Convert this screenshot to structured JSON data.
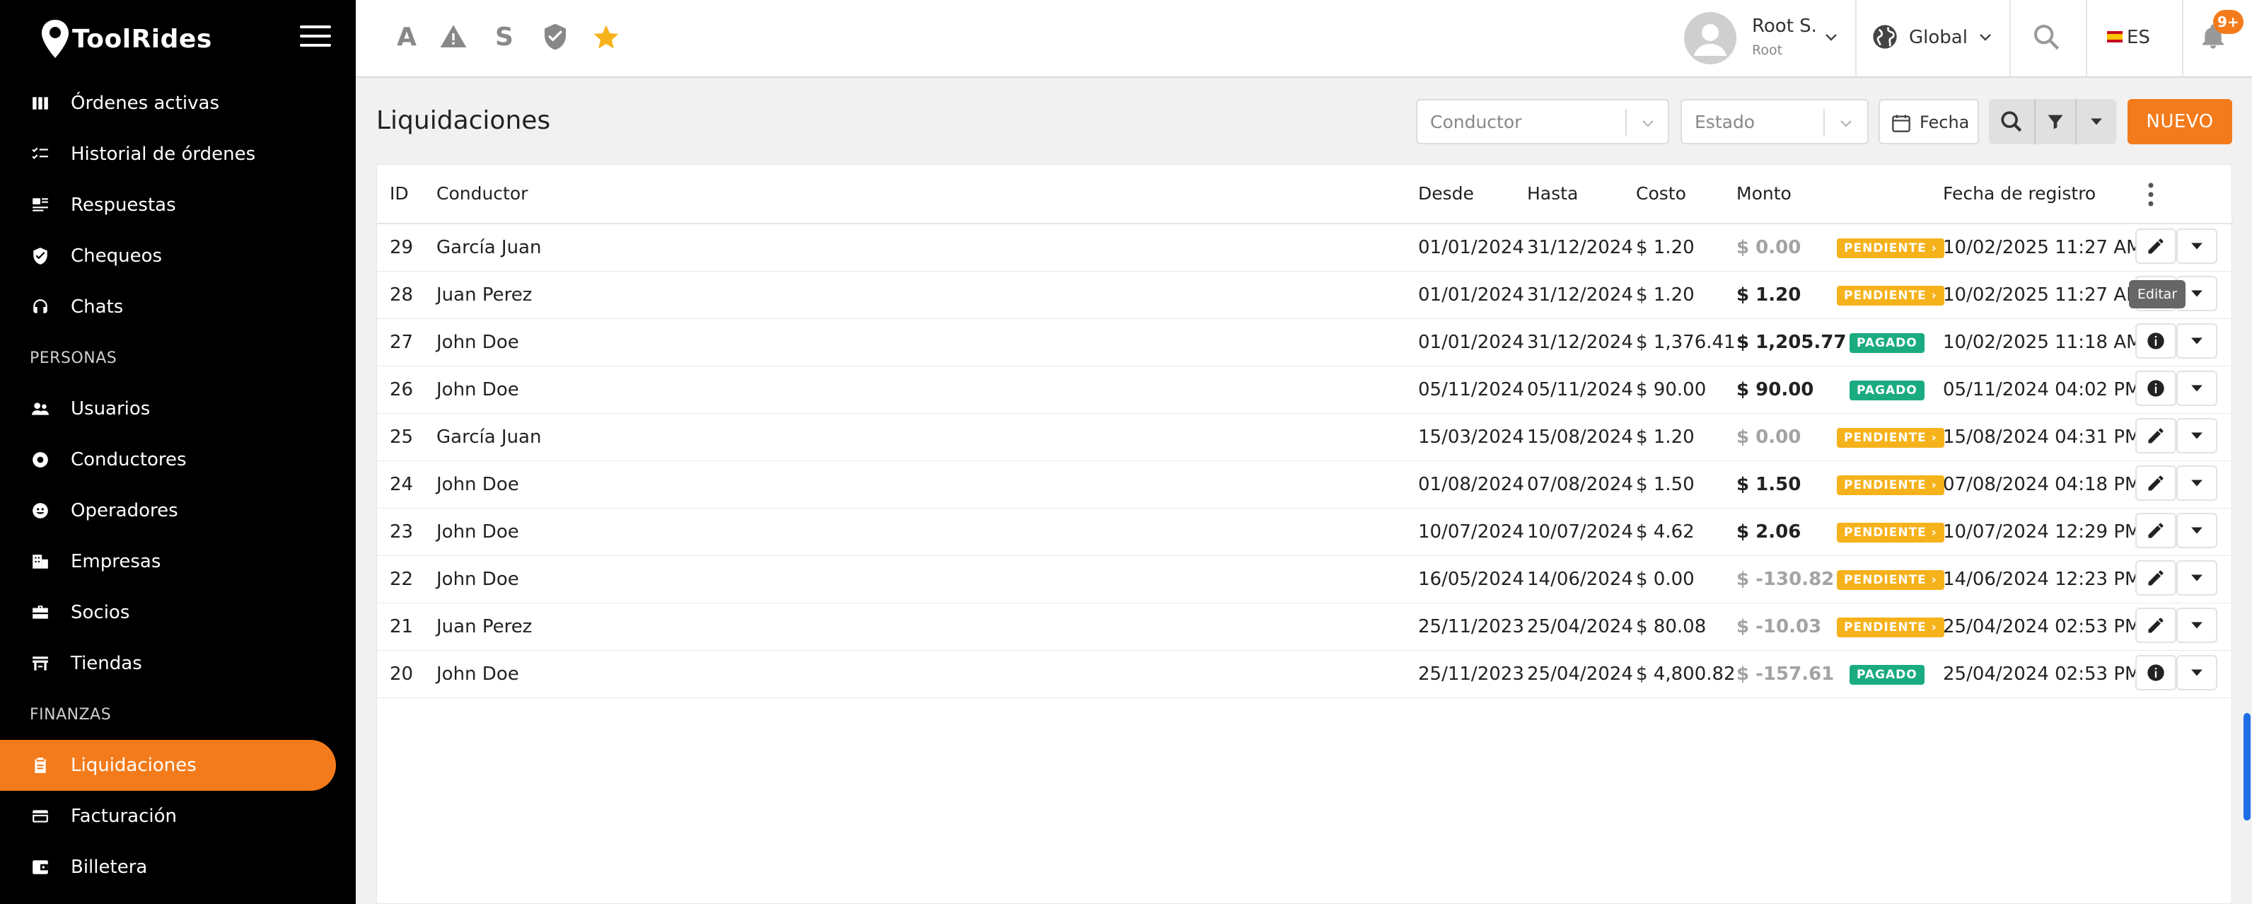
{
  "brand": {
    "name": "ToolRides"
  },
  "sidebar": {
    "items": [
      {
        "label": "Órdenes activas",
        "icon": "columns-icon"
      },
      {
        "label": "Historial de órdenes",
        "icon": "checklist-icon"
      },
      {
        "label": "Respuestas",
        "icon": "replies-icon"
      },
      {
        "label": "Chequeos",
        "icon": "shield-check-icon"
      },
      {
        "label": "Chats",
        "icon": "headset-icon"
      }
    ],
    "section_personas": "PERSONAS",
    "personas": [
      {
        "label": "Usuarios",
        "icon": "users-icon"
      },
      {
        "label": "Conductores",
        "icon": "steering-wheel-icon"
      },
      {
        "label": "Operadores",
        "icon": "operator-icon"
      },
      {
        "label": "Empresas",
        "icon": "building-icon"
      },
      {
        "label": "Socios",
        "icon": "briefcase-icon"
      },
      {
        "label": "Tiendas",
        "icon": "store-icon"
      }
    ],
    "section_finanzas": "FINANZAS",
    "finanzas": [
      {
        "label": "Liquidaciones",
        "icon": "clipboard-icon",
        "active": true
      },
      {
        "label": "Facturación",
        "icon": "credit-card-icon"
      },
      {
        "label": "Billetera",
        "icon": "wallet-icon"
      }
    ]
  },
  "topbar": {
    "shortcuts": [
      "A",
      "S"
    ],
    "user": {
      "name": "Root S.",
      "role": "Root"
    },
    "scope": "Global",
    "language": "ES",
    "notifications": "9+"
  },
  "page": {
    "title": "Liquidaciones",
    "filters": {
      "driver_placeholder": "Conductor",
      "status_placeholder": "Estado",
      "date_label": "Fecha"
    },
    "new_button": "NUEVO",
    "tooltip": "Editar"
  },
  "table": {
    "headers": {
      "id": "ID",
      "driver": "Conductor",
      "from": "Desde",
      "to": "Hasta",
      "cost": "Costo",
      "amount": "Monto",
      "registered": "Fecha de registro"
    },
    "rows": [
      {
        "id": "29",
        "driver": "García Juan",
        "from": "01/01/2024",
        "to": "31/12/2024",
        "cost": "$ 1.20",
        "amount": "$ 0.00",
        "amount_muted": true,
        "status": "PENDIENTE ›",
        "status_kind": "pend",
        "registered": "10/02/2025 11:27 AM",
        "action": "edit"
      },
      {
        "id": "28",
        "driver": "Juan Perez",
        "from": "01/01/2024",
        "to": "31/12/2024",
        "cost": "$ 1.20",
        "amount": "$ 1.20",
        "amount_muted": false,
        "status": "PENDIENTE ›",
        "status_kind": "pend",
        "registered": "10/02/2025 11:27 AM",
        "action": "edit"
      },
      {
        "id": "27",
        "driver": "John Doe",
        "from": "01/01/2024",
        "to": "31/12/2024",
        "cost": "$ 1,376.41",
        "amount": "$ 1,205.77",
        "amount_muted": false,
        "status": "PAGADO",
        "status_kind": "paid",
        "registered": "10/02/2025 11:18 AM",
        "action": "info"
      },
      {
        "id": "26",
        "driver": "John Doe",
        "from": "05/11/2024",
        "to": "05/11/2024",
        "cost": "$ 90.00",
        "amount": "$ 90.00",
        "amount_muted": false,
        "status": "PAGADO",
        "status_kind": "paid",
        "registered": "05/11/2024 04:02 PM",
        "action": "info"
      },
      {
        "id": "25",
        "driver": "García Juan",
        "from": "15/03/2024",
        "to": "15/08/2024",
        "cost": "$ 1.20",
        "amount": "$ 0.00",
        "amount_muted": true,
        "status": "PENDIENTE ›",
        "status_kind": "pend",
        "registered": "15/08/2024 04:31 PM",
        "action": "edit"
      },
      {
        "id": "24",
        "driver": "John Doe",
        "from": "01/08/2024",
        "to": "07/08/2024",
        "cost": "$ 1.50",
        "amount": "$ 1.50",
        "amount_muted": false,
        "status": "PENDIENTE ›",
        "status_kind": "pend",
        "registered": "07/08/2024 04:18 PM",
        "action": "edit"
      },
      {
        "id": "23",
        "driver": "John Doe",
        "from": "10/07/2024",
        "to": "10/07/2024",
        "cost": "$ 4.62",
        "amount": "$ 2.06",
        "amount_muted": false,
        "status": "PENDIENTE ›",
        "status_kind": "pend",
        "registered": "10/07/2024 12:29 PM",
        "action": "edit"
      },
      {
        "id": "22",
        "driver": "John Doe",
        "from": "16/05/2024",
        "to": "14/06/2024",
        "cost": "$ 0.00",
        "amount": "$ -130.82",
        "amount_muted": true,
        "status": "PENDIENTE ›",
        "status_kind": "pend",
        "registered": "14/06/2024 12:23 PM",
        "action": "edit"
      },
      {
        "id": "21",
        "driver": "Juan Perez",
        "from": "25/11/2023",
        "to": "25/04/2024",
        "cost": "$ 80.08",
        "amount": "$ -10.03",
        "amount_muted": true,
        "status": "PENDIENTE ›",
        "status_kind": "pend",
        "registered": "25/04/2024 02:53 PM",
        "action": "edit"
      },
      {
        "id": "20",
        "driver": "John Doe",
        "from": "25/11/2023",
        "to": "25/04/2024",
        "cost": "$ 4,800.82",
        "amount": "$ -157.61",
        "amount_muted": true,
        "status": "PAGADO",
        "status_kind": "paid",
        "registered": "25/04/2024 02:53 PM",
        "action": "info"
      }
    ]
  },
  "colors": {
    "accent": "#f47b1b",
    "pending": "#f6b21b",
    "paid": "#1aab81",
    "sidebar": "#000000"
  }
}
